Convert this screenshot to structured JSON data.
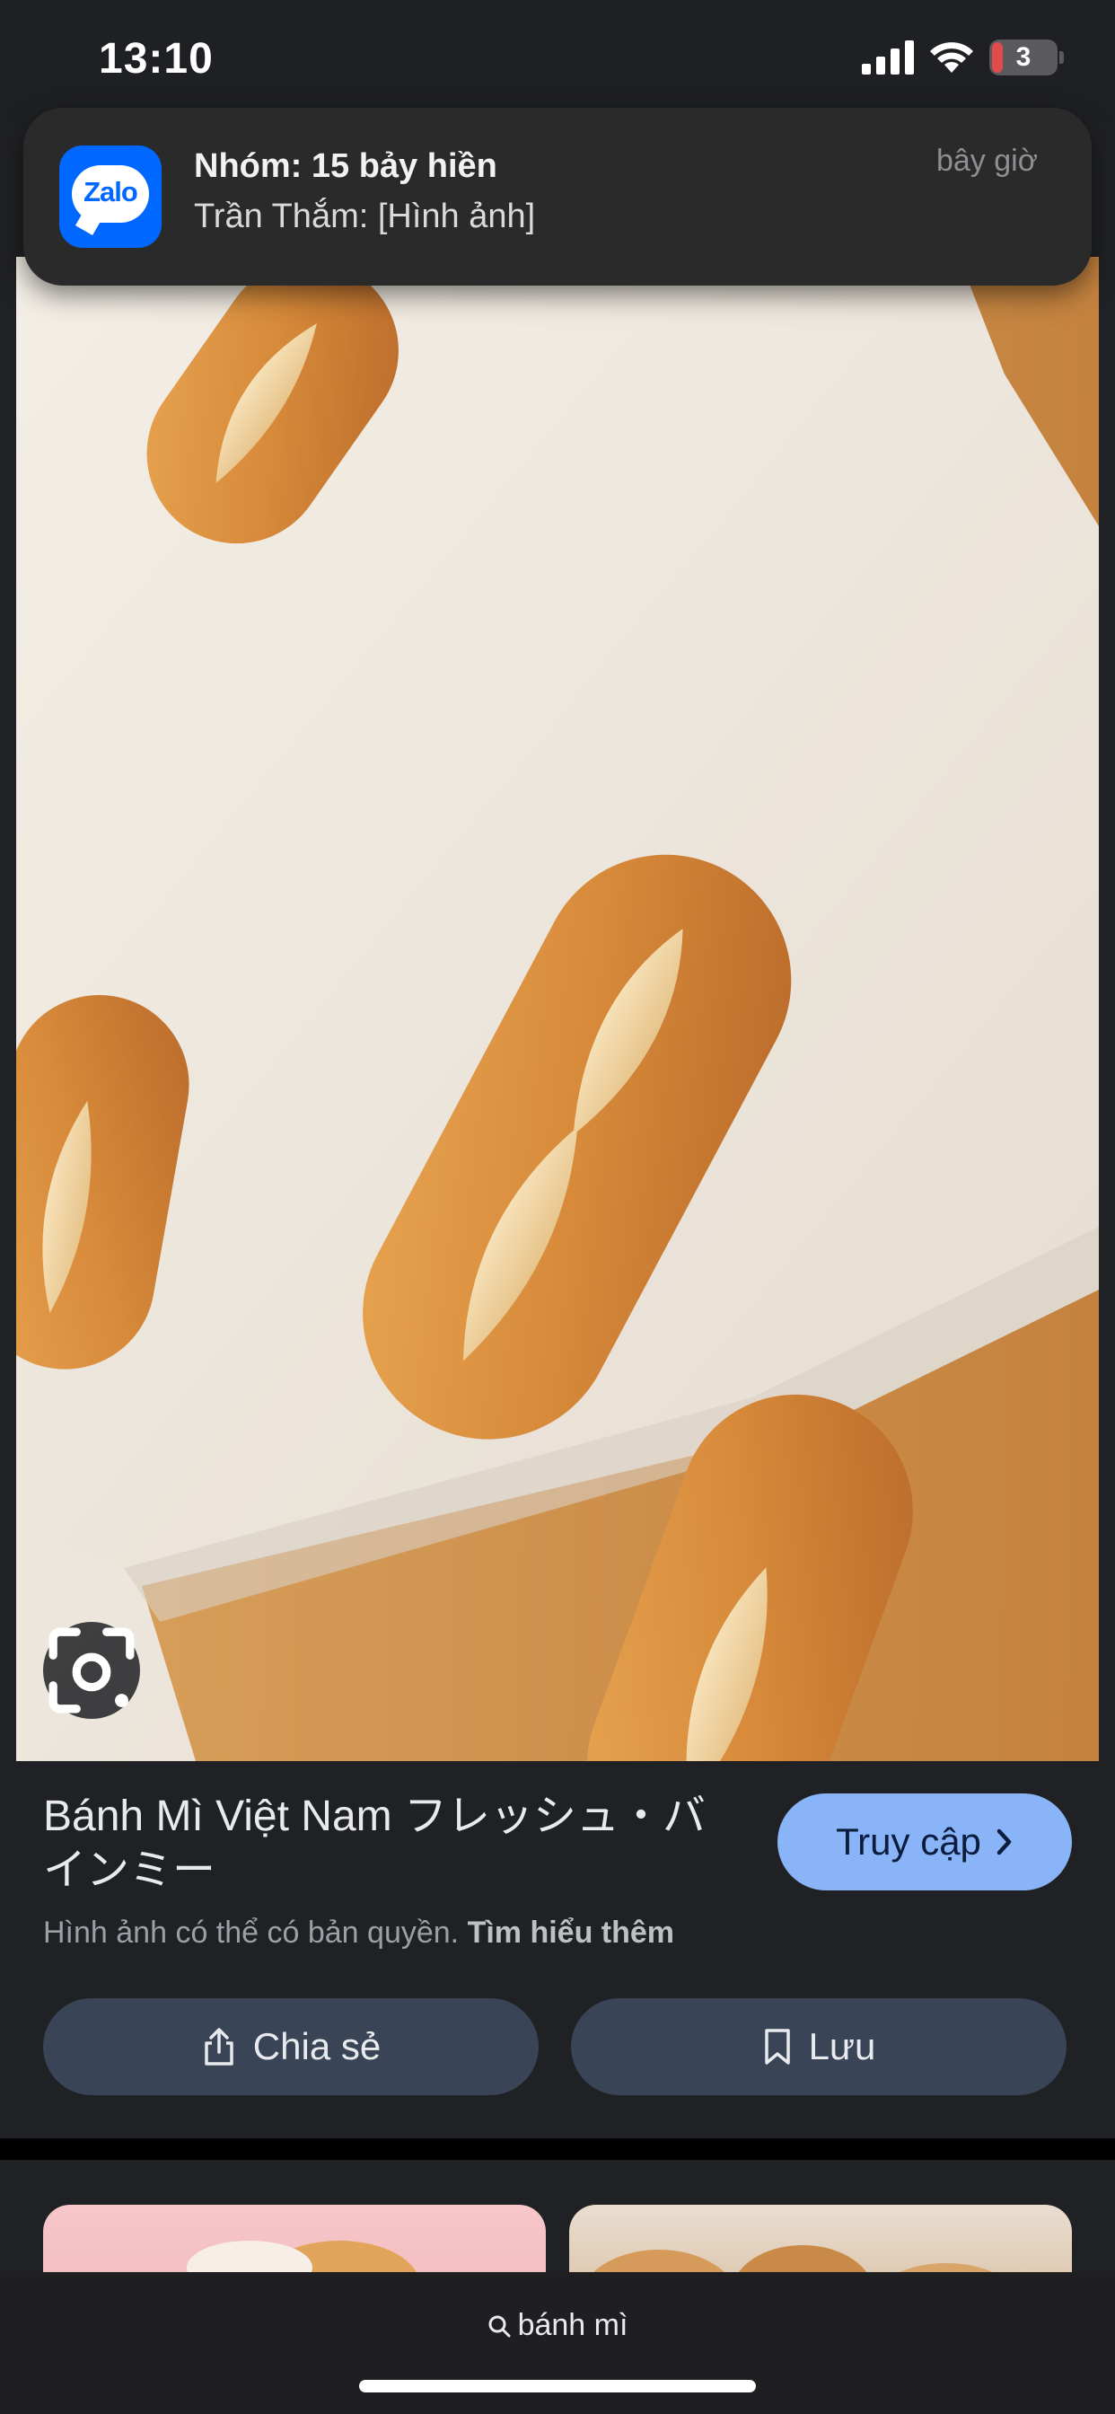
{
  "status_bar": {
    "time": "13:10",
    "battery_level": "3"
  },
  "notification": {
    "app_icon_label": "Zalo",
    "title": "Nhóm: 15 bảy hiền",
    "body": "Trần Thắm: [Hình ảnh]",
    "time": "bây giờ"
  },
  "result": {
    "title": "Bánh Mì Việt Nam フレッシュ・バインミー",
    "visit_label": "Truy cập",
    "copyright_text": "Hình ảnh có thể có bản quyền. ",
    "learn_more_label": "Tìm hiểu thêm",
    "share_label": "Chia sẻ",
    "save_label": "Lưu"
  },
  "search": {
    "query": "bánh mì"
  },
  "colors": {
    "accent_button": "#8ab4f8",
    "action_button": "#394457",
    "zalo_blue": "#0068ff"
  }
}
